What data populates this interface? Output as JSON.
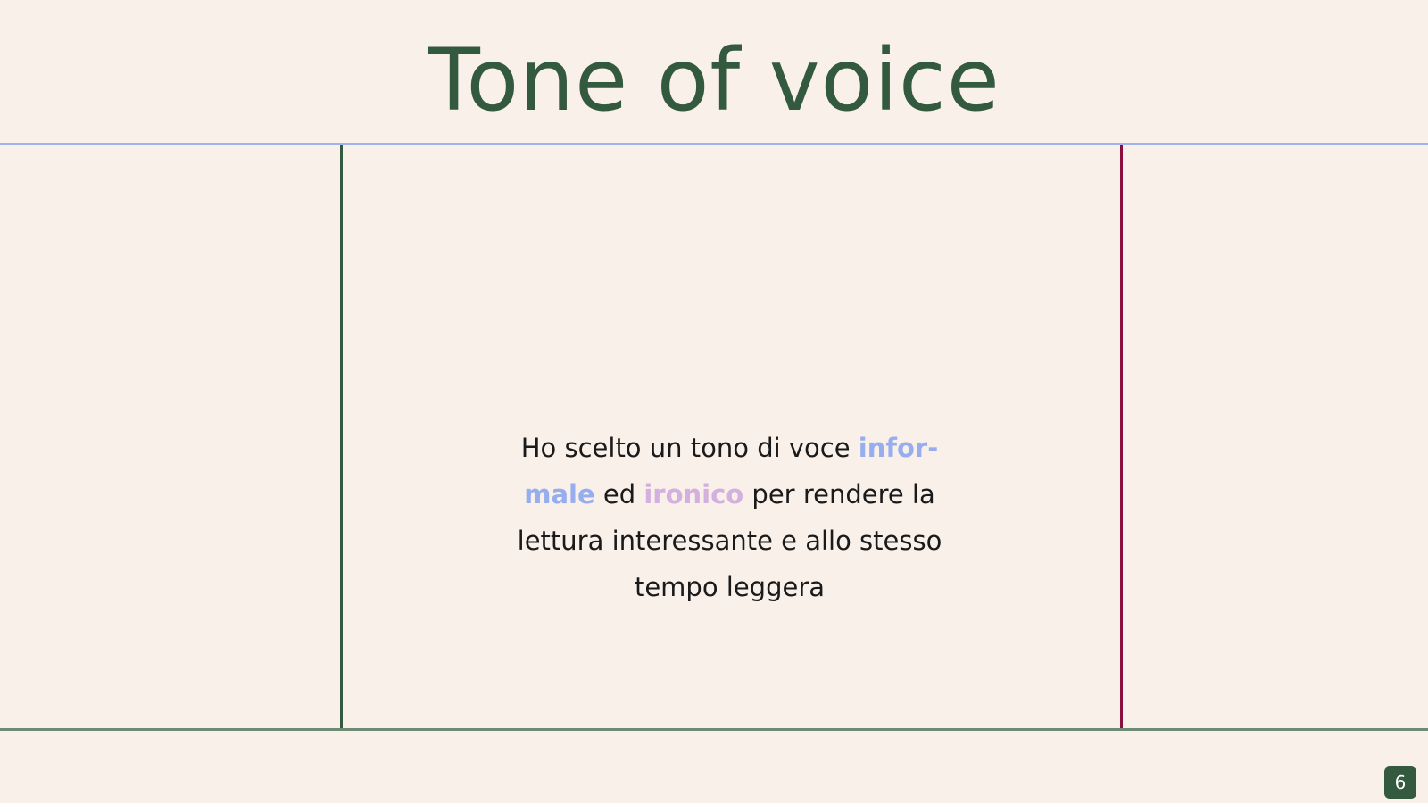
{
  "slide": {
    "title": "Tone of voice",
    "icon": "sound-wave-icon",
    "body": {
      "part1": "Ho scelto un tono di voce ",
      "highlight1_line1": "infor-",
      "highlight1_line2": "male",
      "part2": " ed ",
      "highlight2": "ironico",
      "part3": " per rendere la lettura interessante e allo stesso tempo leggera"
    },
    "page_number": "6"
  },
  "colors": {
    "background": "#f9f0ea",
    "title": "#335a3e",
    "highlight_blue": "#97aeee",
    "highlight_pink": "#d4b0de",
    "top_rule": "#9fb3f0",
    "bottom_rule": "#6e8a72",
    "left_line": "#335a3e",
    "right_line": "#8a0f3f",
    "badge": "#335a3e"
  }
}
